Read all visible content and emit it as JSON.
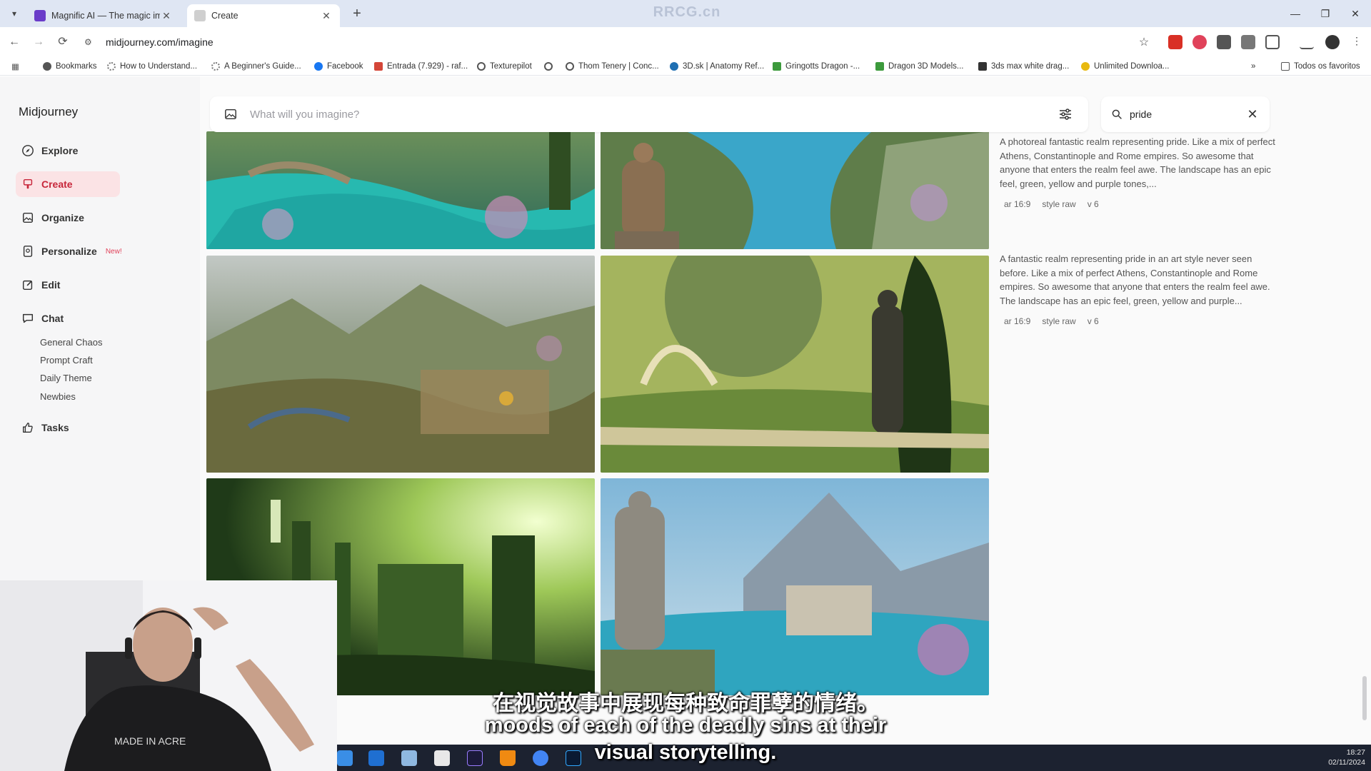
{
  "browser": {
    "tabs": [
      {
        "title": "Magnific AI — The magic imag",
        "active": false,
        "favicon_color": "#6a3cc9"
      },
      {
        "title": "Create",
        "active": true,
        "favicon_color": "#bbbbbb"
      }
    ],
    "top_watermark": "RRCG.cn",
    "url": "midjourney.com/imagine",
    "bookmarks": [
      {
        "label": "Bookmarks",
        "icon": "star-icon"
      },
      {
        "label": "How to Understand...",
        "icon": "loading-icon"
      },
      {
        "label": "A Beginner's Guide...",
        "icon": "loading-icon"
      },
      {
        "label": "Facebook",
        "icon": "facebook-icon"
      },
      {
        "label": "Entrada (7.929) - raf...",
        "icon": "gmail-icon"
      },
      {
        "label": "Texturepilot",
        "icon": "globe-icon"
      },
      {
        "label": "",
        "icon": "globe-icon"
      },
      {
        "label": "Thom Tenery | Conc...",
        "icon": "globe-icon"
      },
      {
        "label": "3D.sk | Anatomy Ref...",
        "icon": "3dsk-icon"
      },
      {
        "label": "Gringotts Dragon -...",
        "icon": "green-square-icon"
      },
      {
        "label": "Dragon 3D Models...",
        "icon": "green-square-icon"
      },
      {
        "label": "3ds max white drag...",
        "icon": "image-icon"
      },
      {
        "label": "Unlimited Downloa...",
        "icon": "s-yellow-icon"
      }
    ],
    "bookmarks_overflow": "»",
    "all_bookmarks": "Todos os favoritos"
  },
  "sidebar": {
    "brand": "Midjourney",
    "items": [
      {
        "label": "Explore",
        "icon": "compass-icon",
        "active": false
      },
      {
        "label": "Create",
        "icon": "brush-icon",
        "active": true
      },
      {
        "label": "Organize",
        "icon": "image-grid-icon",
        "active": false
      },
      {
        "label": "Personalize",
        "icon": "personalize-icon",
        "active": false,
        "badge": "New!"
      },
      {
        "label": "Edit",
        "icon": "edit-icon",
        "active": false
      },
      {
        "label": "Chat",
        "icon": "chat-icon",
        "active": false
      },
      {
        "label": "Tasks",
        "icon": "thumbs-up-icon",
        "active": false
      }
    ],
    "chat_rooms": [
      "General Chaos",
      "Prompt Craft",
      "Daily Theme",
      "Newbies"
    ]
  },
  "search": {
    "imagine_placeholder": "What will you imagine?",
    "filter_value": "pride"
  },
  "jobs": [
    {
      "prompt": "A photoreal fantastic realm representing pride. Like a mix of perfect Athens, Constantinople and Rome empires. So awesome that anyone that enters the realm feel awe. The landscape has an epic feel, green, yellow and purple tones,...",
      "params": [
        "ar 16:9",
        "style raw",
        "v 6"
      ]
    },
    {
      "prompt": "A fantastic realm representing pride in an art style never seen before. Like a mix of perfect Athens, Constantinople and Rome empires. So awesome that anyone that enters the realm feel awe. The landscape has an epic feel, green, yellow and purple...",
      "params": [
        "ar 16:9",
        "style raw",
        "v 6"
      ]
    }
  ],
  "images": [
    {
      "name": "realm-image-turquoise-bridges",
      "palette": [
        "#2bb3a7",
        "#5a8a3a",
        "#c98bb8"
      ]
    },
    {
      "name": "realm-image-statue-river",
      "palette": [
        "#3aa6c9",
        "#6b8a4a",
        "#b08f5a"
      ]
    },
    {
      "name": "realm-image-aerial-city",
      "palette": [
        "#8fa0a0",
        "#6a7a4a",
        "#a58a5a"
      ]
    },
    {
      "name": "realm-image-garden-statue",
      "palette": [
        "#9bb25a",
        "#3d5a28",
        "#d8c878"
      ]
    },
    {
      "name": "realm-image-green-ruins",
      "palette": [
        "#c8e48a",
        "#4f7a2a",
        "#1f3a18"
      ]
    },
    {
      "name": "realm-image-coastal-statues",
      "palette": [
        "#3ab0c4",
        "#8a9aa8",
        "#c47ab0"
      ]
    }
  ],
  "subtitles": {
    "cn": "在视觉故事中展现每种致命罪孽的情绪。",
    "en_line1": "moods of each of the deadly sins at their",
    "en_line2": "visual storytelling."
  },
  "taskbar": {
    "time": "18:27",
    "date": "02/11/2024",
    "apps": [
      "windows-icon",
      "outlook-icon",
      "notepad-icon",
      "file-icon",
      "after-effects-icon",
      "vlc-icon",
      "chrome-icon",
      "photoshop-icon"
    ]
  },
  "webcam": {
    "shirt_text": "MADE IN ACRE"
  },
  "colors": {
    "accent": "#c7263a",
    "accent_bg": "#fbe3e5",
    "badge": "#e0425a"
  }
}
